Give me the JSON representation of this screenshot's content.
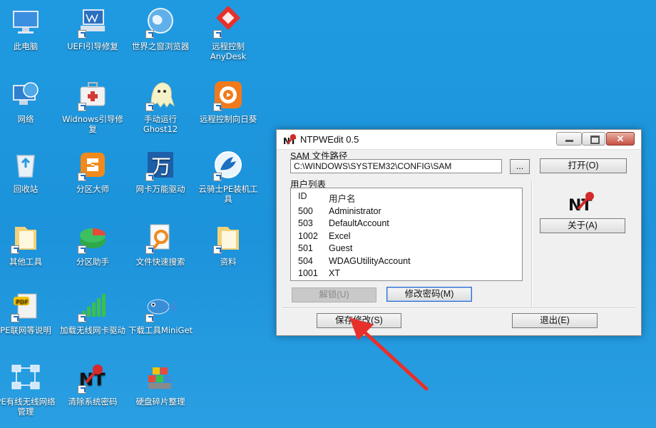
{
  "desktop": {
    "icons": [
      {
        "label": "此电脑",
        "icon": "computer-icon"
      },
      {
        "label": "UEFI引导修复",
        "icon": "uefi-repair-icon"
      },
      {
        "label": "世界之窗浏览器",
        "icon": "browser-globe-icon"
      },
      {
        "label": "远程控制AnyDesk",
        "icon": "anydesk-icon"
      },
      {
        "label": "网络",
        "icon": "network-icon"
      },
      {
        "label": "Widnows引导修复",
        "icon": "first-aid-kit-icon"
      },
      {
        "label": "手动运行Ghost12",
        "icon": "ghost-icon"
      },
      {
        "label": "远程控制向日葵",
        "icon": "sunflower-icon"
      },
      {
        "label": "回收站",
        "icon": "recycle-bin-icon"
      },
      {
        "label": "分区大师",
        "icon": "partition-master-icon"
      },
      {
        "label": "网卡万能驱动",
        "icon": "network-driver-icon"
      },
      {
        "label": "云骑士PE装机工具",
        "icon": "knight-icon"
      },
      {
        "label": "其他工具",
        "icon": "folder-icon"
      },
      {
        "label": "分区助手",
        "icon": "partition-assistant-icon"
      },
      {
        "label": "文件快速搜索",
        "icon": "file-search-icon"
      },
      {
        "label": "资料",
        "icon": "folder-icon"
      },
      {
        "label": "PE联网等说明",
        "icon": "pdf-doc-icon"
      },
      {
        "label": "加载无线网卡驱动",
        "icon": "wifi-bars-icon"
      },
      {
        "label": "下载工具MiniGet",
        "icon": "fish-icon"
      },
      {
        "label": "PE有线无线网络管理",
        "icon": "network-topology-icon"
      },
      {
        "label": "清除系统密码",
        "icon": "nt-key-icon"
      },
      {
        "label": "硬盘碎片整理",
        "icon": "defrag-blocks-icon"
      }
    ]
  },
  "window": {
    "title": "NTPWEdit 0.5",
    "close_glyph": "✕",
    "sam_label": "SAM 文件路径",
    "sam_path": "C:\\WINDOWS\\SYSTEM32\\CONFIG\\SAM",
    "browse_label": "...",
    "open_label": "打开(O)",
    "user_list_label": "用户列表",
    "col_id": "ID",
    "col_name": "用户名",
    "users": [
      {
        "id": "500",
        "name": "Administrator"
      },
      {
        "id": "503",
        "name": "DefaultAccount"
      },
      {
        "id": "1002",
        "name": "Excel"
      },
      {
        "id": "501",
        "name": "Guest"
      },
      {
        "id": "504",
        "name": "WDAGUtilityAccount"
      },
      {
        "id": "1001",
        "name": "XT"
      }
    ],
    "unlock_label": "解锁(U)",
    "change_password_label": "修改密码(M)",
    "about_label": "关于(A)",
    "save_label": "保存修改(S)",
    "exit_label": "退出(E)"
  },
  "colors": {
    "desktop_bg": "#1f9ae0",
    "annotation_arrow": "#e8302a"
  }
}
